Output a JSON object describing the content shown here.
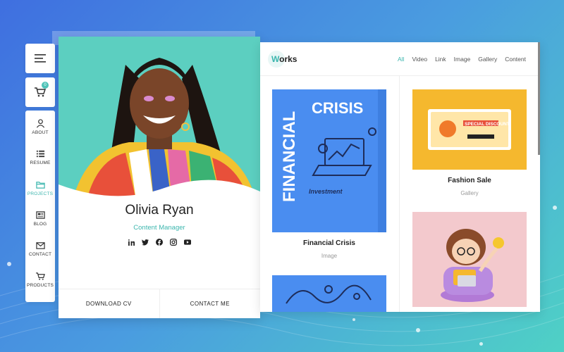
{
  "nav": {
    "cart_count": "0",
    "items": [
      {
        "label": "ABOUT",
        "icon": "user-icon"
      },
      {
        "label": "RESUME",
        "icon": "list-icon"
      },
      {
        "label": "PROJECTS",
        "icon": "folder-icon"
      },
      {
        "label": "BLOG",
        "icon": "newspaper-icon"
      },
      {
        "label": "CONTACT",
        "icon": "mail-icon"
      },
      {
        "label": "PRODUCTS",
        "icon": "cart-icon"
      }
    ]
  },
  "profile": {
    "name": "Olivia Ryan",
    "role": "Content Manager",
    "socials": [
      "linkedin-icon",
      "twitter-icon",
      "facebook-icon",
      "instagram-icon",
      "youtube-icon"
    ],
    "download_label": "DOWNLOAD CV",
    "contact_label": "CONTACT ME"
  },
  "works": {
    "title_first": "W",
    "title_rest": "orks",
    "filters": [
      "All",
      "Video",
      "Link",
      "Image",
      "Gallery",
      "Content"
    ],
    "active_filter": "All",
    "items": [
      {
        "title": "Financial Crisis",
        "category": "Image",
        "poster_word1": "CRISIS",
        "poster_word2": "FINANCIAL",
        "poster_word3": "Investment"
      },
      {
        "title": "Fashion Sale",
        "category": "Gallery",
        "poster_text": "SPECIAL DISCOUNT!"
      }
    ]
  },
  "colors": {
    "accent": "#3cb6ae",
    "poster_blue": "#4a8df0",
    "poster_yellow": "#f5b82e",
    "poster_pink": "#f3c9cd"
  }
}
